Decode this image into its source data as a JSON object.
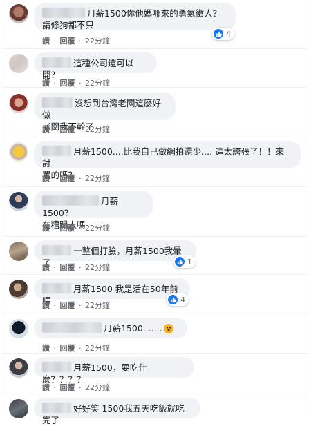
{
  "actions": {
    "like": "讚",
    "dot": "·",
    "reply": "回覆",
    "time": "22分鐘"
  },
  "colors": {
    "bubble": "#f0f2f5",
    "like_blue": "#1877f2",
    "meta_gray": "#65676b"
  },
  "comments": [
    {
      "text1": "月薪1500你他媽哪來的勇氣徵人？",
      "text2": "請條狗都不只",
      "reaction_icon": "like-icon",
      "reaction_count": "4"
    },
    {
      "text1": "這種公司還可以開？"
    },
    {
      "text1": "沒想到台灣老闆這麼好做",
      "text2": "老闆我不幹了"
    },
    {
      "text1": "月薪1500....比我自己做網拍還少.... 這太誇張了！！來討",
      "text2": "罵的嗎？"
    },
    {
      "text1": "月薪1500？",
      "text2": "在糟蹋人嗎"
    },
    {
      "text1": "一整個打臉，月薪1500我暈了",
      "reaction_icon": "like-icon",
      "reaction_count": "1"
    },
    {
      "text1": "月薪1500 我是活在50年前嗎",
      "reaction_icon": "like-icon",
      "reaction_count": "4"
    },
    {
      "text1": "月薪1500.......",
      "emoji_icon": "wow-icon"
    },
    {
      "text1": "月薪1500，要吃什麼？？？？"
    },
    {
      "text1": "好好笑 1500我五天吃飯就吃完了"
    }
  ]
}
